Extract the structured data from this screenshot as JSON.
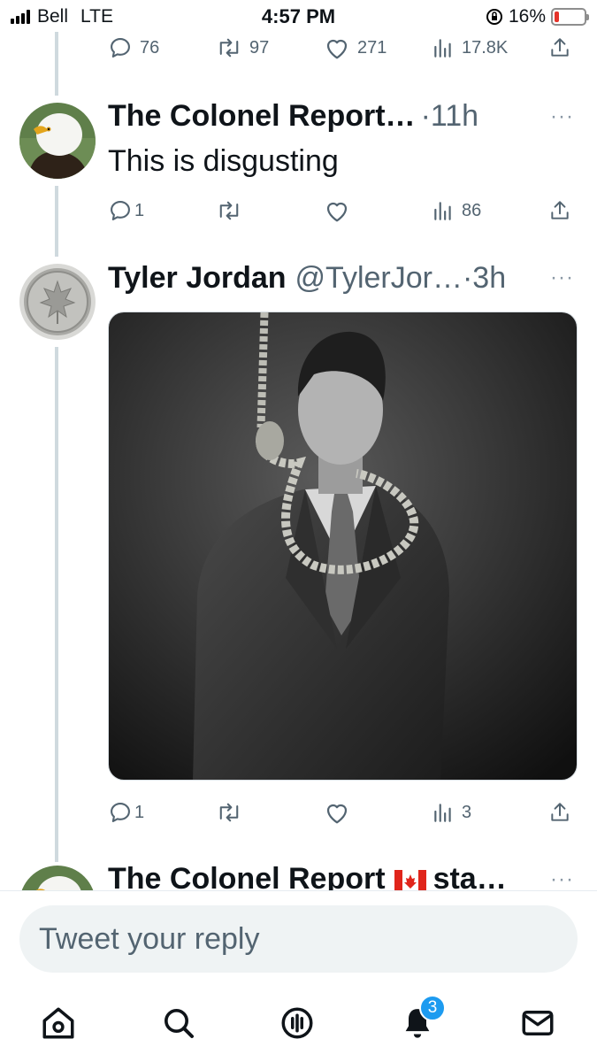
{
  "status_bar": {
    "carrier": "Bell",
    "network": "LTE",
    "time": "4:57 PM",
    "battery": "16%",
    "battery_level": 0.16
  },
  "top_actions": {
    "replies": "76",
    "retweets": "97",
    "likes": "271",
    "views": "17.8K"
  },
  "tweets": [
    {
      "name": "The Colonel Report…",
      "time": "·11h",
      "text": "This is disgusting",
      "replies": "1",
      "views": "86",
      "avatar": "eagle-avatar"
    },
    {
      "name": "Tyler Jordan",
      "handle": "@TylerJor…",
      "time": "·3h",
      "replies": "1",
      "views": "3",
      "avatar": "coin-avatar",
      "media": "photo"
    }
  ],
  "partial_tweet": {
    "name": "The Colonel Report",
    "suffix": "sta…"
  },
  "more_glyph": "···",
  "reply": {
    "placeholder": "Tweet your reply"
  },
  "tabbar": {
    "notifications_badge": "3"
  },
  "colors": {
    "accent": "#1d9bf0",
    "muted": "#536471",
    "thread_line": "#cfd9de"
  }
}
